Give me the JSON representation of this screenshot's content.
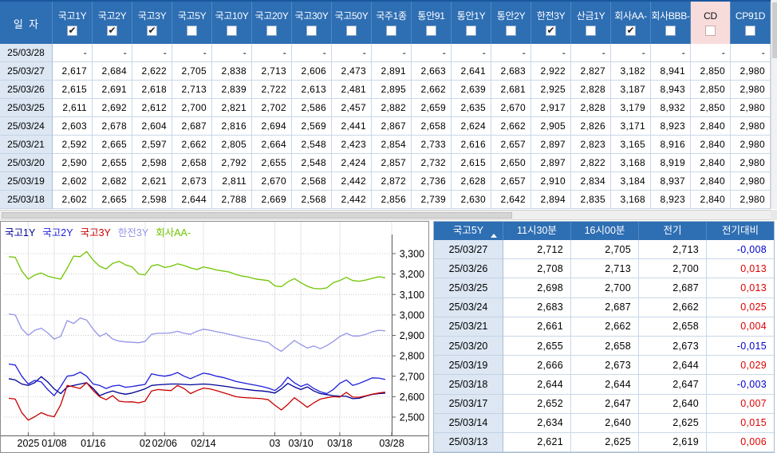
{
  "top_table": {
    "date_header": "일  자",
    "columns": [
      {
        "label": "국고1Y",
        "checked": true,
        "highlight": false
      },
      {
        "label": "국고2Y",
        "checked": true,
        "highlight": false
      },
      {
        "label": "국고3Y",
        "checked": true,
        "highlight": false
      },
      {
        "label": "국고5Y",
        "checked": false,
        "highlight": false
      },
      {
        "label": "국고10Y",
        "checked": false,
        "highlight": false
      },
      {
        "label": "국고20Y",
        "checked": false,
        "highlight": false
      },
      {
        "label": "국고30Y",
        "checked": false,
        "highlight": false
      },
      {
        "label": "국고50Y",
        "checked": false,
        "highlight": false
      },
      {
        "label": "국주1종",
        "checked": false,
        "highlight": false
      },
      {
        "label": "통안91",
        "checked": false,
        "highlight": false
      },
      {
        "label": "통안1Y",
        "checked": false,
        "highlight": false
      },
      {
        "label": "통안2Y",
        "checked": false,
        "highlight": false
      },
      {
        "label": "한전3Y",
        "checked": true,
        "highlight": false
      },
      {
        "label": "산금1Y",
        "checked": false,
        "highlight": false
      },
      {
        "label": "회사AA-",
        "checked": true,
        "highlight": false
      },
      {
        "label": "회사BBB-",
        "checked": false,
        "highlight": false
      },
      {
        "label": "CD",
        "checked": false,
        "highlight": true
      },
      {
        "label": "CP91D",
        "checked": false,
        "highlight": false
      }
    ],
    "rows": [
      {
        "date": "25/03/28",
        "values": [
          "-",
          "-",
          "-",
          "-",
          "-",
          "-",
          "-",
          "-",
          "-",
          "-",
          "-",
          "-",
          "-",
          "-",
          "-",
          "-",
          "-",
          "-"
        ]
      },
      {
        "date": "25/03/27",
        "values": [
          "2,617",
          "2,684",
          "2,622",
          "2,705",
          "2,838",
          "2,713",
          "2,606",
          "2,473",
          "2,891",
          "2,663",
          "2,641",
          "2,683",
          "2,922",
          "2,827",
          "3,182",
          "8,941",
          "2,850",
          "2,980"
        ]
      },
      {
        "date": "25/03/26",
        "values": [
          "2,615",
          "2,691",
          "2,618",
          "2,713",
          "2,839",
          "2,722",
          "2,613",
          "2,481",
          "2,895",
          "2,662",
          "2,639",
          "2,681",
          "2,925",
          "2,828",
          "3,187",
          "8,943",
          "2,850",
          "2,980"
        ]
      },
      {
        "date": "25/03/25",
        "values": [
          "2,611",
          "2,692",
          "2,612",
          "2,700",
          "2,821",
          "2,702",
          "2,586",
          "2,457",
          "2,882",
          "2,659",
          "2,635",
          "2,670",
          "2,917",
          "2,828",
          "3,179",
          "8,932",
          "2,850",
          "2,980"
        ]
      },
      {
        "date": "25/03/24",
        "values": [
          "2,603",
          "2,678",
          "2,604",
          "2,687",
          "2,816",
          "2,694",
          "2,569",
          "2,441",
          "2,867",
          "2,658",
          "2,624",
          "2,662",
          "2,905",
          "2,826",
          "3,171",
          "8,923",
          "2,840",
          "2,980"
        ]
      },
      {
        "date": "25/03/21",
        "values": [
          "2,592",
          "2,665",
          "2,597",
          "2,662",
          "2,805",
          "2,664",
          "2,548",
          "2,423",
          "2,854",
          "2,733",
          "2,616",
          "2,657",
          "2,897",
          "2,823",
          "3,165",
          "8,916",
          "2,840",
          "2,980"
        ]
      },
      {
        "date": "25/03/20",
        "values": [
          "2,590",
          "2,655",
          "2,598",
          "2,658",
          "2,792",
          "2,655",
          "2,548",
          "2,424",
          "2,857",
          "2,732",
          "2,615",
          "2,650",
          "2,897",
          "2,822",
          "3,168",
          "8,919",
          "2,840",
          "2,980"
        ]
      },
      {
        "date": "25/03/19",
        "values": [
          "2,602",
          "2,682",
          "2,621",
          "2,673",
          "2,811",
          "2,670",
          "2,568",
          "2,442",
          "2,872",
          "2,736",
          "2,628",
          "2,657",
          "2,910",
          "2,834",
          "3,184",
          "8,937",
          "2,840",
          "2,980"
        ]
      },
      {
        "date": "25/03/18",
        "values": [
          "2,602",
          "2,665",
          "2,598",
          "2,644",
          "2,788",
          "2,669",
          "2,568",
          "2,442",
          "2,856",
          "2,739",
          "2,630",
          "2,642",
          "2,894",
          "2,835",
          "3,168",
          "8,923",
          "2,840",
          "2,980"
        ]
      }
    ]
  },
  "chart_data": {
    "type": "line",
    "legend_position": "top-left",
    "grid": true,
    "ylim": [
      2.4,
      3.39
    ],
    "y_ticks": [
      2.5,
      2.6,
      2.7,
      2.8,
      2.9,
      3.0,
      3.1,
      3.2,
      3.3
    ],
    "y_tick_labels": [
      "2,500",
      "2,600",
      "2,700",
      "2,800",
      "2,900",
      "3,000",
      "3,100",
      "3,200",
      "3,300"
    ],
    "x_tick_labels": [
      "2025",
      "01/08",
      "01/16",
      "02",
      "02/06",
      "02/14",
      "03",
      "03/10",
      "03/18",
      "03/28"
    ],
    "x_tick_indices": [
      3,
      7,
      13,
      21,
      24,
      30,
      41,
      45,
      51,
      59
    ],
    "x_count": 60,
    "series": [
      {
        "name": "국고1Y",
        "color": "#000096",
        "values": [
          2.688,
          2.682,
          2.662,
          2.655,
          2.668,
          2.698,
          2.672,
          2.638,
          2.615,
          2.648,
          2.655,
          2.662,
          2.668,
          2.64,
          2.605,
          2.618,
          2.628,
          2.618,
          2.612,
          2.618,
          2.628,
          2.638,
          2.655,
          2.658,
          2.66,
          2.662,
          2.662,
          2.66,
          2.658,
          2.66,
          2.662,
          2.66,
          2.656,
          2.652,
          2.648,
          2.642,
          2.638,
          2.634,
          2.63,
          2.628,
          2.624,
          2.618,
          2.638,
          2.665,
          2.648,
          2.635,
          2.648,
          2.628,
          2.615,
          2.61,
          2.605,
          2.602,
          2.602,
          2.59,
          2.592,
          2.603,
          2.611,
          2.615,
          2.617
        ]
      },
      {
        "name": "국고2Y",
        "color": "#1E1EDC",
        "values": [
          2.76,
          2.755,
          2.7,
          2.662,
          2.68,
          2.672,
          2.635,
          2.605,
          2.65,
          2.7,
          2.705,
          2.72,
          2.7,
          2.662,
          2.655,
          2.64,
          2.652,
          2.656,
          2.646,
          2.65,
          2.655,
          2.66,
          2.712,
          2.705,
          2.7,
          2.706,
          2.718,
          2.7,
          2.688,
          2.702,
          2.715,
          2.71,
          2.7,
          2.694,
          2.685,
          2.675,
          2.668,
          2.662,
          2.656,
          2.65,
          2.642,
          2.63,
          2.655,
          2.695,
          2.668,
          2.65,
          2.662,
          2.64,
          2.624,
          2.615,
          2.635,
          2.665,
          2.682,
          2.655,
          2.665,
          2.678,
          2.692,
          2.691,
          2.684
        ]
      },
      {
        "name": "국고3Y",
        "color": "#C80000",
        "values": [
          2.592,
          2.588,
          2.522,
          2.485,
          2.502,
          2.522,
          2.508,
          2.502,
          2.56,
          2.655,
          2.648,
          2.64,
          2.668,
          2.63,
          2.6,
          2.585,
          2.605,
          2.578,
          2.574,
          2.575,
          2.57,
          2.578,
          2.628,
          2.635,
          2.632,
          2.63,
          2.655,
          2.64,
          2.615,
          2.63,
          2.642,
          2.638,
          2.63,
          2.62,
          2.61,
          2.6,
          2.596,
          2.594,
          2.592,
          2.59,
          2.585,
          2.558,
          2.535,
          2.562,
          2.595,
          2.572,
          2.548,
          2.57,
          2.588,
          2.595,
          2.6,
          2.598,
          2.621,
          2.598,
          2.597,
          2.604,
          2.612,
          2.618,
          2.622
        ]
      },
      {
        "name": "한전3Y",
        "color": "#9494E8",
        "values": [
          3.005,
          3.0,
          2.932,
          2.9,
          2.925,
          2.935,
          2.912,
          2.882,
          2.895,
          2.972,
          2.958,
          2.985,
          2.975,
          2.93,
          2.895,
          2.91,
          2.882,
          2.872,
          2.868,
          2.866,
          2.864,
          2.87,
          2.905,
          2.91,
          2.91,
          2.912,
          2.92,
          2.91,
          2.905,
          2.92,
          2.93,
          2.925,
          2.918,
          2.912,
          2.905,
          2.898,
          2.89,
          2.884,
          2.878,
          2.872,
          2.865,
          2.84,
          2.822,
          2.848,
          2.875,
          2.855,
          2.838,
          2.848,
          2.835,
          2.85,
          2.87,
          2.894,
          2.91,
          2.897,
          2.897,
          2.905,
          2.917,
          2.925,
          2.922
        ]
      },
      {
        "name": "회사AA-",
        "color": "#6FC400",
        "values": [
          3.285,
          3.282,
          3.215,
          3.175,
          3.195,
          3.205,
          3.19,
          3.182,
          3.175,
          3.228,
          3.288,
          3.285,
          3.31,
          3.268,
          3.238,
          3.225,
          3.252,
          3.262,
          3.245,
          3.235,
          3.2,
          3.196,
          3.24,
          3.246,
          3.232,
          3.238,
          3.25,
          3.242,
          3.23,
          3.222,
          3.235,
          3.228,
          3.22,
          3.215,
          3.21,
          3.198,
          3.19,
          3.185,
          3.176,
          3.172,
          3.168,
          3.142,
          3.138,
          3.162,
          3.178,
          3.158,
          3.14,
          3.13,
          3.128,
          3.132,
          3.158,
          3.168,
          3.184,
          3.168,
          3.165,
          3.171,
          3.179,
          3.187,
          3.182
        ]
      }
    ]
  },
  "right_table": {
    "title": "국고5Y",
    "columns": [
      "11시30분",
      "16시00분",
      "전기",
      "전기대비"
    ],
    "diff_positive_color": "#DE0000",
    "diff_negative_color": "#0000CC",
    "rows": [
      {
        "date": "25/03/27",
        "t1130": "2,712",
        "t1600": "2,705",
        "prev": "2,713",
        "diff": "-0,008"
      },
      {
        "date": "25/03/26",
        "t1130": "2,708",
        "t1600": "2,713",
        "prev": "2,700",
        "diff": "0,013"
      },
      {
        "date": "25/03/25",
        "t1130": "2,698",
        "t1600": "2,700",
        "prev": "2,687",
        "diff": "0,013"
      },
      {
        "date": "25/03/24",
        "t1130": "2,683",
        "t1600": "2,687",
        "prev": "2,662",
        "diff": "0,025"
      },
      {
        "date": "25/03/21",
        "t1130": "2,661",
        "t1600": "2,662",
        "prev": "2,658",
        "diff": "0,004"
      },
      {
        "date": "25/03/20",
        "t1130": "2,655",
        "t1600": "2,658",
        "prev": "2,673",
        "diff": "-0,015"
      },
      {
        "date": "25/03/19",
        "t1130": "2,666",
        "t1600": "2,673",
        "prev": "2,644",
        "diff": "0,029"
      },
      {
        "date": "25/03/18",
        "t1130": "2,644",
        "t1600": "2,644",
        "prev": "2,647",
        "diff": "-0,003"
      },
      {
        "date": "25/03/17",
        "t1130": "2,652",
        "t1600": "2,647",
        "prev": "2,640",
        "diff": "0,007"
      },
      {
        "date": "25/03/14",
        "t1130": "2,634",
        "t1600": "2,640",
        "prev": "2,625",
        "diff": "0,015"
      },
      {
        "date": "25/03/13",
        "t1130": "2,621",
        "t1600": "2,625",
        "prev": "2,619",
        "diff": "0,006"
      }
    ]
  },
  "colors": {
    "header_bg": "#2E6EB3",
    "date_cell_bg": "#DCE7F3",
    "highlight_header_bg": "#F8DCDC",
    "grid_border": "#C9D8E8"
  }
}
